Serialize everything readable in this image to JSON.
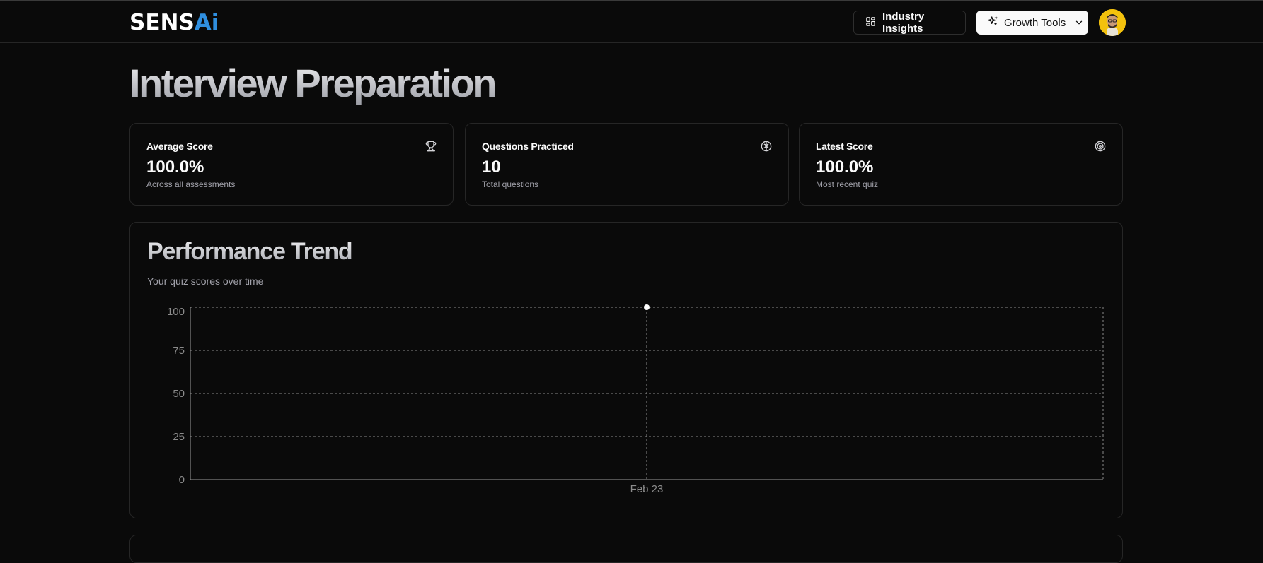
{
  "header": {
    "logo_main": "SENS",
    "logo_accent": "Ai",
    "industry_insights_label": "Industry Insights",
    "growth_tools_label": "Growth Tools",
    "icons": {
      "industry_insights": "layout-dashboard-icon",
      "growth_tools": "sparkles-icon",
      "growth_tools_caret": "chevron-down-icon"
    },
    "avatar_bg": "#f4c20d"
  },
  "page": {
    "title": "Interview Preparation"
  },
  "stats": [
    {
      "label": "Average Score",
      "value": "100.0%",
      "sub": "Across all assessments",
      "icon": "trophy-icon"
    },
    {
      "label": "Questions Practiced",
      "value": "10",
      "sub": "Total questions",
      "icon": "brain-icon"
    },
    {
      "label": "Latest Score",
      "value": "100.0%",
      "sub": "Most recent quiz",
      "icon": "target-icon"
    }
  ],
  "trend": {
    "title": "Performance Trend",
    "subtitle": "Your quiz scores over time"
  },
  "chart_data": {
    "type": "line",
    "x": [
      "Feb 23"
    ],
    "series": [
      {
        "values": [
          100
        ]
      }
    ],
    "yticks": [
      0,
      25,
      50,
      75,
      100
    ],
    "ylim": [
      0,
      100
    ],
    "grid": true,
    "line_color": "#ffffff",
    "grid_color": "#8a8a8a"
  }
}
